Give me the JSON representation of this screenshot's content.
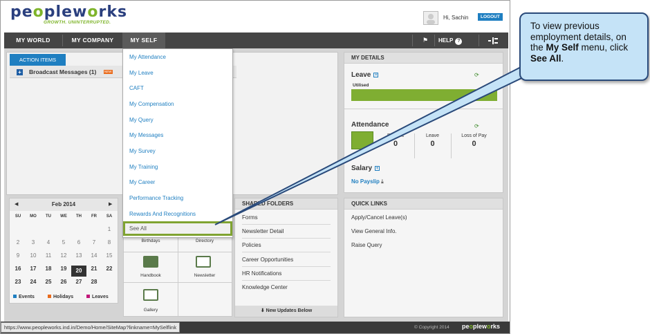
{
  "app": {
    "logo_text_a": "pe",
    "logo_text_o": "o",
    "logo_text_b": "plew",
    "logo_text_o2": "o",
    "logo_text_c": "rks",
    "tagline": "GROWTH. UNINTERRUPTED."
  },
  "header": {
    "greeting": "Hi,  Sachin",
    "logout_label": "LOGOUT"
  },
  "nav": {
    "items": [
      {
        "label": "MY WORLD"
      },
      {
        "label": "MY COMPANY"
      },
      {
        "label": "MY SELF"
      }
    ],
    "help_label": "HELP"
  },
  "action_items": {
    "tab_label": "ACTION ITEMS",
    "broadcast_label": "Broadcast Messages (1)",
    "new_badge": "NEW"
  },
  "dropdown": {
    "items": [
      "My Attendance",
      "My Leave",
      "CAFT",
      "My Compensation",
      "My Query",
      "My Messages",
      "My Survey",
      "My Training",
      "My Career",
      "Performance Tracking",
      "Rewards And Recognitions"
    ],
    "see_all": "See All"
  },
  "calendar": {
    "month": "Feb 2014",
    "weekdays": [
      "SU",
      "MO",
      "TU",
      "WE",
      "TH",
      "FR",
      "SA"
    ],
    "rows": [
      [
        "",
        "",
        "",
        "",
        "",
        "",
        "1"
      ],
      [
        "2",
        "3",
        "4",
        "5",
        "6",
        "7",
        "8"
      ],
      [
        "9",
        "10",
        "11",
        "12",
        "13",
        "14",
        "15"
      ],
      [
        "16",
        "17",
        "18",
        "19",
        "20",
        "21",
        "22"
      ],
      [
        "23",
        "24",
        "25",
        "26",
        "27",
        "28",
        ""
      ]
    ],
    "today": "20",
    "legend": [
      {
        "label": "Events",
        "color": "#1f7fc1"
      },
      {
        "label": "Holidays",
        "color": "#e96b1c"
      },
      {
        "label": "Leaves",
        "color": "#c2187a"
      }
    ]
  },
  "quick_icons": {
    "birthdays": "Birthdays",
    "directory": "Directory",
    "handbook": "Handbook",
    "newsletter": "Newsletter",
    "gallery": "Gallery"
  },
  "shared_folders": {
    "title": "SHARED FOLDERS",
    "items": [
      "Forms",
      "Newsletter Detail",
      "Policies",
      "Career Opportunities",
      "HR Notifications",
      "Knowledge Center"
    ],
    "footer": "New Updates Below"
  },
  "quick_links": {
    "title": "QUICK LINKS",
    "items": [
      "Apply/Cancel Leave(s)",
      "View General Info.",
      "Raise Query"
    ]
  },
  "my_details": {
    "title": "MY DETAILS",
    "leave_title": "Leave",
    "utilised_label": "Utilised",
    "attendance_title": "Attendance",
    "att_cols": [
      {
        "label": "Present",
        "value": "0"
      },
      {
        "label": "Leave",
        "value": "0"
      },
      {
        "label": "Loss of Pay",
        "value": "0"
      }
    ],
    "salary_title": "Salary",
    "payslip_label": "No Payslip"
  },
  "statusbar": {
    "url": "https://www.peopleworks.ind.in/Demo/Home/SiteMap?linkname=MySelflink",
    "copyright": "© Copyright 2014"
  },
  "callout": {
    "line1": "To view previous employment details, on the ",
    "bold1": "My Self",
    "line2": " menu, click ",
    "bold2": "See All",
    "line3": "."
  },
  "colors": {
    "accent": "#1f7fc1",
    "brand_green": "#7eb42a",
    "nav_bg": "#454545",
    "highlight": "#7fa331"
  }
}
